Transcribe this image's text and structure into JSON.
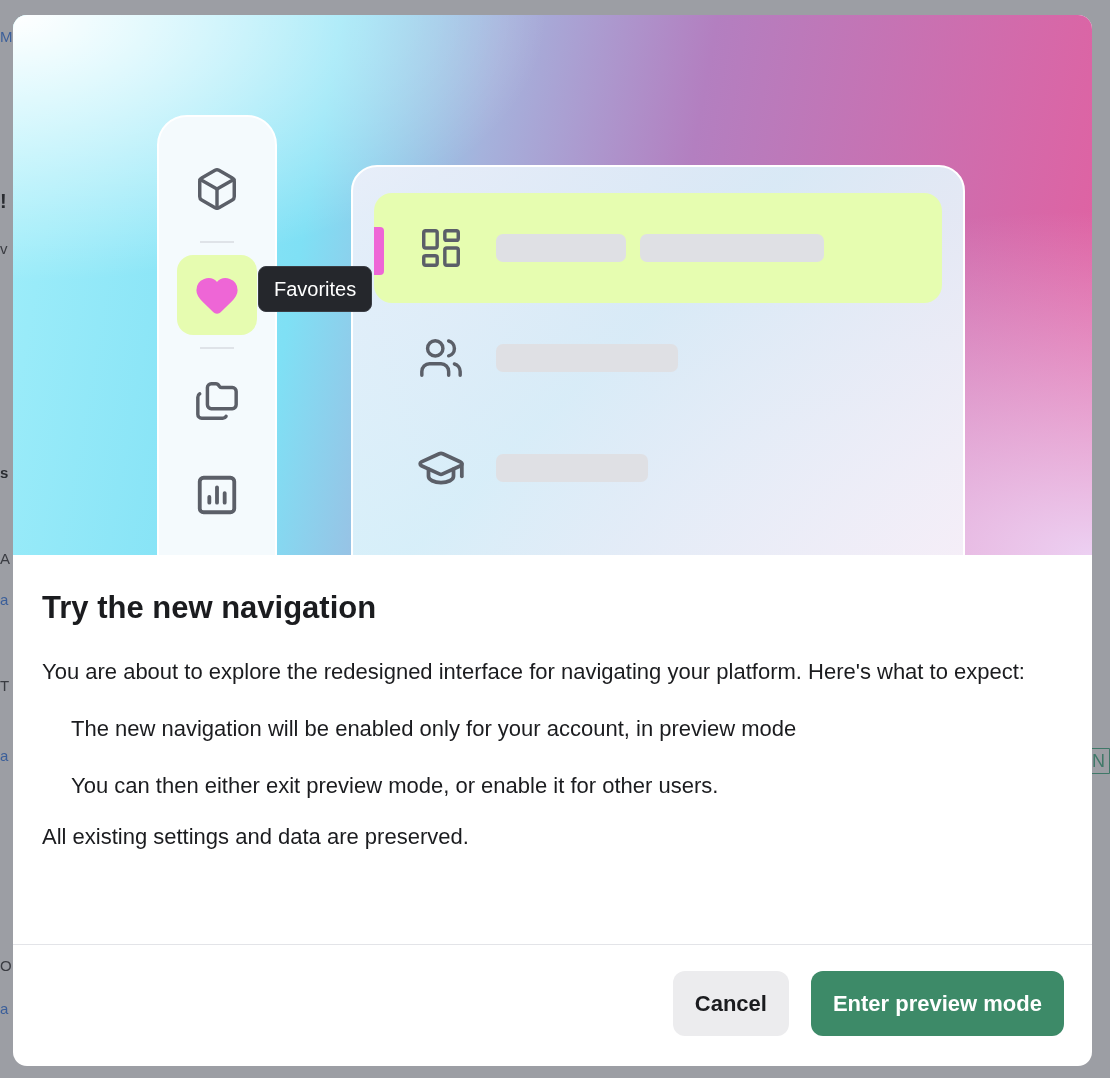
{
  "background": {
    "left_fragments": [
      {
        "text": "M",
        "kind": "link"
      },
      {
        "text": "!",
        "kind": "heading"
      },
      {
        "text": "v",
        "kind": "text"
      },
      {
        "text": "s",
        "kind": "heading"
      },
      {
        "text": "A",
        "kind": "text"
      },
      {
        "text": "a",
        "kind": "link"
      },
      {
        "text": "T",
        "kind": "text"
      },
      {
        "text": "a",
        "kind": "link"
      },
      {
        "text": "O",
        "kind": "text"
      },
      {
        "text": "a",
        "kind": "link"
      }
    ],
    "right_tag": "N"
  },
  "illustration": {
    "rail_items": [
      {
        "selected": false
      },
      {
        "selected": true
      },
      {
        "selected": false
      },
      {
        "selected": false
      }
    ],
    "tooltip": "Favorites",
    "list_rows": [
      {
        "selected": true
      },
      {
        "selected": false
      },
      {
        "selected": false
      }
    ]
  },
  "dialog": {
    "title": "Try the new navigation",
    "intro": "You are about to explore the redesigned interface for navigating your platform. Here's what to expect:",
    "points": [
      "The new navigation will be enabled only for your account, in preview mode",
      "You can then either exit preview mode, or enable it for other users."
    ],
    "outro": "All existing settings and data are preserved.",
    "buttons": [
      {
        "label": "Cancel",
        "kind": "secondary"
      },
      {
        "label": "Enter preview mode",
        "kind": "primary"
      }
    ]
  }
}
